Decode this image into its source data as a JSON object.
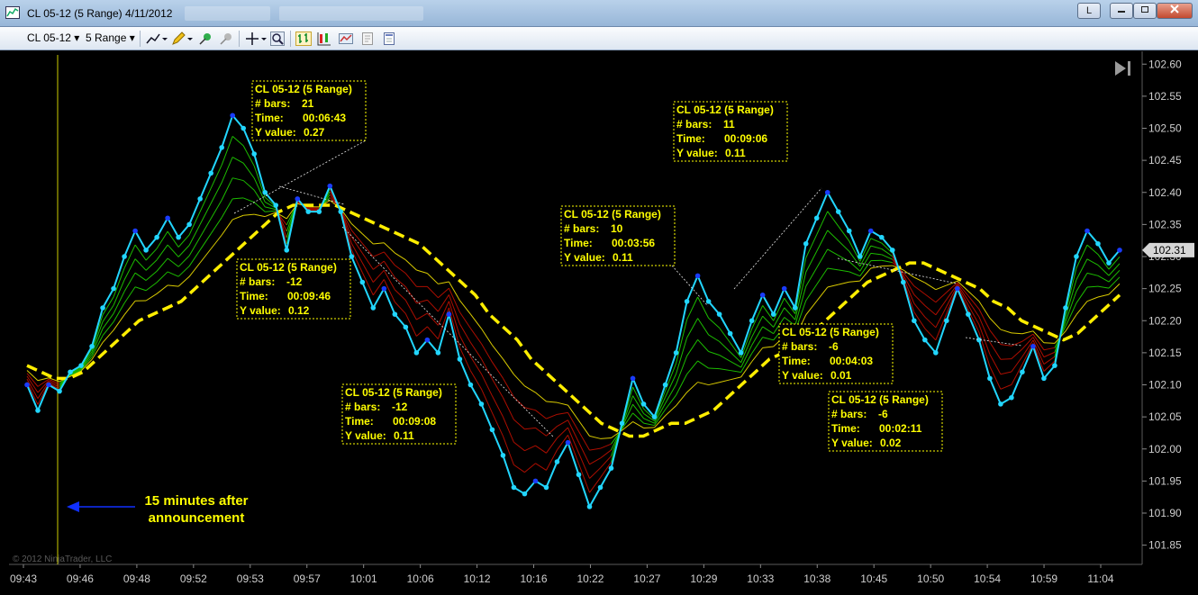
{
  "window": {
    "title": "CL 05-12 (5 Range)  4/11/2012",
    "mode_button": "L"
  },
  "toolbar": {
    "instrument": "CL 05-12",
    "period": "5 Range"
  },
  "copyright": "© 2012 NinjaTrader, LLC",
  "chart_data": {
    "type": "line",
    "title": "",
    "ylim": [
      101.82,
      102.62
    ],
    "yticks": [
      "102.60",
      "102.55",
      "102.50",
      "102.45",
      "102.40",
      "102.35",
      "102.30",
      "102.25",
      "102.20",
      "102.15",
      "102.10",
      "102.05",
      "102.00",
      "101.95",
      "101.90",
      "101.85"
    ],
    "xticks": [
      "09:43",
      "09:46",
      "09:48",
      "09:52",
      "09:53",
      "09:57",
      "10:01",
      "10:06",
      "10:12",
      "10:16",
      "10:22",
      "10:27",
      "10:29",
      "10:33",
      "10:38",
      "10:45",
      "10:50",
      "10:54",
      "10:59",
      "11:04"
    ],
    "last_price": "102.31",
    "grid": false,
    "colors": {
      "price": "#22d6ff",
      "ma": "#ffee00",
      "up_ribbon": "#22dd00",
      "down_ribbon": "#cc1100",
      "annotation": "#ffff00",
      "axis_text": "#cfcfcf"
    },
    "series": [
      {
        "values": [
          102.1,
          102.06,
          102.1,
          102.09,
          102.12,
          102.13,
          102.16,
          102.22,
          102.25,
          102.3,
          102.34,
          102.31,
          102.33,
          102.36,
          102.33,
          102.35,
          102.39,
          102.43,
          102.47,
          102.52,
          102.5,
          102.46,
          102.4,
          102.38,
          102.31,
          102.39,
          102.37,
          102.37,
          102.41,
          102.37,
          102.3,
          102.26,
          102.22,
          102.25,
          102.21,
          102.19,
          102.15,
          102.17,
          102.15,
          102.21,
          102.14,
          102.1,
          102.07,
          102.03,
          101.99,
          101.94,
          101.93,
          101.95,
          101.94,
          101.98,
          102.01,
          101.96,
          101.91,
          101.94,
          101.97,
          102.04,
          102.11,
          102.07,
          102.05,
          102.1,
          102.15,
          102.23,
          102.27,
          102.23,
          102.21,
          102.18,
          102.15,
          102.2,
          102.24,
          102.21,
          102.25,
          102.22,
          102.32,
          102.36,
          102.4,
          102.37,
          102.34,
          102.3,
          102.34,
          102.33,
          102.31,
          102.26,
          102.2,
          102.17,
          102.15,
          102.2,
          102.25,
          102.21,
          102.17,
          102.11,
          102.07,
          102.08,
          102.12,
          102.16,
          102.11,
          102.13,
          102.22,
          102.3,
          102.34,
          102.32,
          102.29,
          102.31
        ]
      },
      {
        "values": [
          102.13,
          102.12,
          102.11,
          102.11,
          102.12,
          102.14,
          102.16,
          102.18,
          102.2,
          102.21,
          102.22,
          102.23,
          102.25,
          102.27,
          102.29,
          102.31,
          102.33,
          102.35,
          102.37,
          102.38,
          102.38,
          102.38,
          102.38,
          102.37,
          102.36,
          102.35,
          102.34,
          102.33,
          102.32,
          102.3,
          102.28,
          102.26,
          102.24,
          102.21,
          102.19,
          102.17,
          102.14,
          102.12,
          102.1,
          102.08,
          102.06,
          102.04,
          102.03,
          102.02,
          102.02,
          102.03,
          102.04,
          102.04,
          102.05,
          102.06,
          102.08,
          102.1,
          102.12,
          102.14,
          102.15,
          102.16,
          102.18,
          102.2,
          102.22,
          102.24,
          102.26,
          102.27,
          102.28,
          102.29,
          102.29,
          102.28,
          102.27,
          102.26,
          102.25,
          102.23,
          102.22,
          102.2,
          102.19,
          102.18,
          102.17,
          102.18,
          102.2,
          102.22,
          102.24
        ]
      }
    ],
    "annotations": [
      {
        "title": "CL 05-12 (5 Range)",
        "bars_label": "# bars:",
        "bars": "21",
        "time_label": "Time:",
        "time": "00:06:43",
        "y_label": "Y value:",
        "y": "0.27"
      },
      {
        "title": "CL 05-12 (5 Range)",
        "bars_label": "# bars:",
        "bars": "-12",
        "time_label": "Time:",
        "time": "00:09:46",
        "y_label": "Y value:",
        "y": "0.12"
      },
      {
        "title": "CL 05-12 (5 Range)",
        "bars_label": "# bars:",
        "bars": "-12",
        "time_label": "Time:",
        "time": "00:09:08",
        "y_label": "Y value:",
        "y": "0.11"
      },
      {
        "title": "CL 05-12 (5 Range)",
        "bars_label": "# bars:",
        "bars": "10",
        "time_label": "Time:",
        "time": "00:03:56",
        "y_label": "Y value:",
        "y": "0.11"
      },
      {
        "title": "CL 05-12 (5 Range)",
        "bars_label": "# bars:",
        "bars": "11",
        "time_label": "Time:",
        "time": "00:09:06",
        "y_label": "Y value:",
        "y": "0.11"
      },
      {
        "title": "CL 05-12 (5 Range)",
        "bars_label": "# bars:",
        "bars": "-6",
        "time_label": "Time:",
        "time": "00:04:03",
        "y_label": "Y value:",
        "y": "0.01"
      },
      {
        "title": "CL 05-12 (5 Range)",
        "bars_label": "# bars:",
        "bars": "-6",
        "time_label": "Time:",
        "time": "00:02:11",
        "y_label": "Y value:",
        "y": "0.02"
      }
    ],
    "callout": {
      "line1": "15 minutes after",
      "line2": "announcement"
    }
  }
}
